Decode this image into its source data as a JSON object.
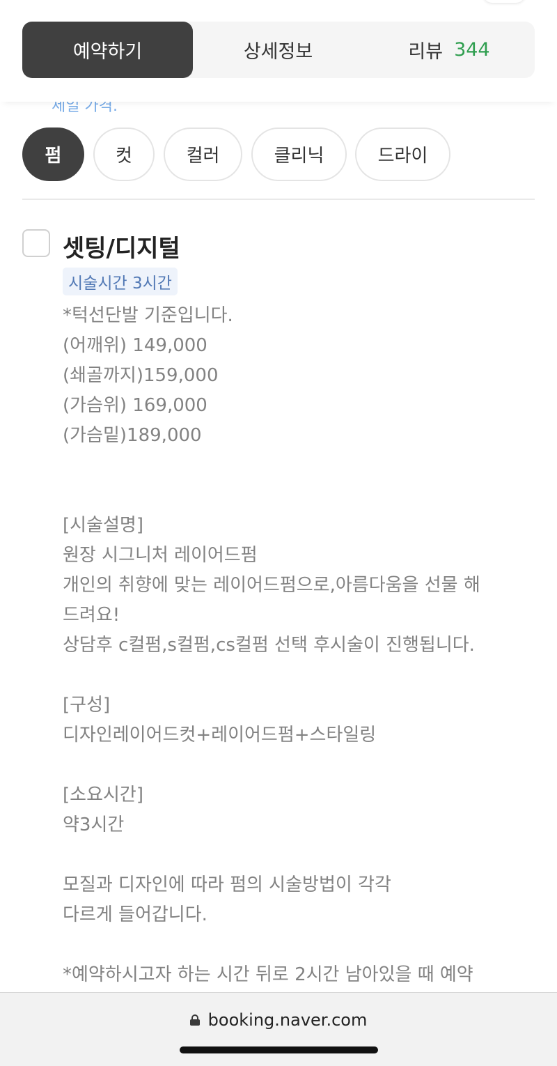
{
  "tabs": {
    "reservation": "예약하기",
    "details": "상세정보",
    "reviews_label": "리뷰",
    "reviews_count": "344"
  },
  "peek_text": "세일 가격.",
  "categories": [
    "펌",
    "컷",
    "컬러",
    "클리닉",
    "드라이"
  ],
  "item": {
    "title": "셋팅/디지털",
    "duration_badge": "시술시간 3시간",
    "description_lines": [
      "*턱선단발 기준입니다.",
      "(어깨위) 149,000",
      "(쇄골까지)159,000",
      "(가슴위) 169,000",
      "(가슴밑)189,000",
      "",
      "",
      "[시술설명]",
      "원장 시그니처 레이어드펌",
      "개인의 취향에 맞는 레이어드펌으로,아름다움을 선물 해",
      "드려요!",
      "상담후 c컬펌,s컬펌,cs컬펌 선택 후시술이 진행됩니다.",
      "",
      "[구성]",
      "디자인레이어드컷+레이어드펌+스타일링",
      "",
      "[소요시간]",
      "약3시간",
      "",
      "모질과 디자인에 따라 펌의 시술방법이 각각",
      "다르게 들어갑니다.",
      "",
      "*예약하시고자 하는 시간 뒤로 2시간 남아있을 때 예약"
    ]
  },
  "browser": {
    "url": "booking.naver.com"
  },
  "colors": {
    "active_tab": "#404040",
    "review_count": "#2f9e4f",
    "badge_text": "#5279b5",
    "badge_bg": "#eef3fb"
  }
}
